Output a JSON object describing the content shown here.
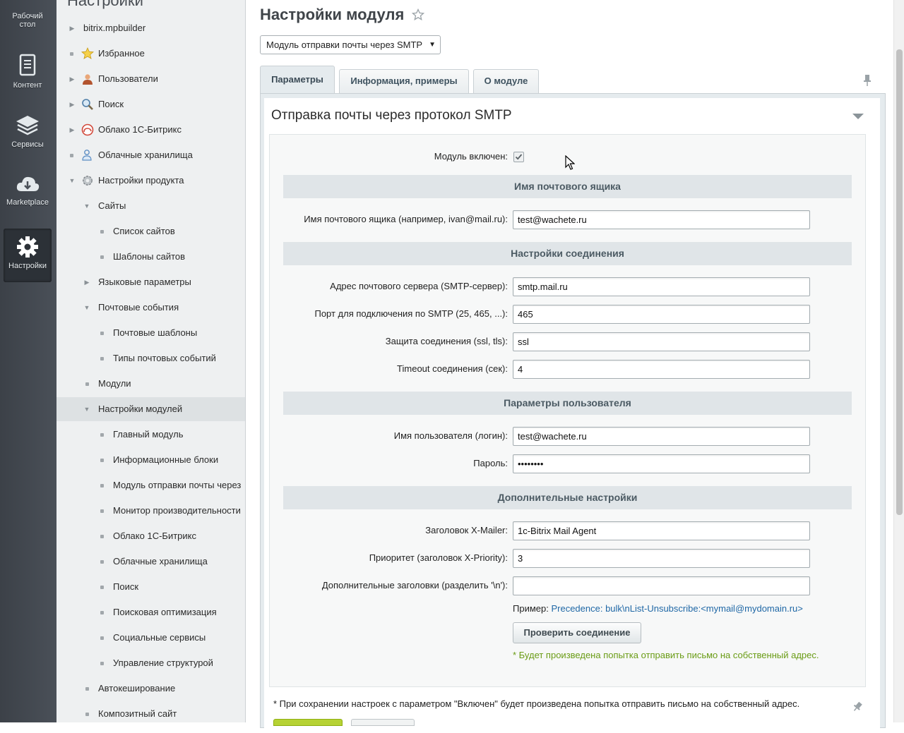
{
  "leftbar": {
    "items": [
      {
        "label": "Рабочий стол",
        "icon": "desktop-icon"
      },
      {
        "label": "Контент",
        "icon": "document-icon"
      },
      {
        "label": "Сервисы",
        "icon": "layers-icon"
      },
      {
        "label": "Marketplace",
        "icon": "cloud-download-icon"
      },
      {
        "label": "Настройки",
        "icon": "gear-icon"
      }
    ]
  },
  "menu": {
    "title": "Настройки",
    "items": [
      {
        "label": "bitrix.mpbuilder",
        "marker": "arrow-right"
      },
      {
        "label": "Избранное",
        "marker": "bullet",
        "icon": "star-icon"
      },
      {
        "label": "Пользователи",
        "marker": "arrow-right",
        "icon": "user-icon"
      },
      {
        "label": "Поиск",
        "marker": "arrow-right",
        "icon": "magnifier-icon"
      },
      {
        "label": "Облако 1С-Битрикс",
        "marker": "arrow-right",
        "icon": "cloud-icon"
      },
      {
        "label": "Облачные хранилища",
        "marker": "bullet",
        "icon": "storage-icon"
      },
      {
        "label": "Настройки продукта",
        "marker": "arrow-down",
        "icon": "settings-icon"
      },
      {
        "label": "Сайты",
        "marker": "arrow-down"
      },
      {
        "label": "Список сайтов",
        "marker": "bullet"
      },
      {
        "label": "Шаблоны сайтов",
        "marker": "bullet"
      },
      {
        "label": "Языковые параметры",
        "marker": "arrow-right"
      },
      {
        "label": "Почтовые события",
        "marker": "arrow-down"
      },
      {
        "label": "Почтовые шаблоны",
        "marker": "bullet"
      },
      {
        "label": "Типы почтовых событий",
        "marker": "bullet"
      },
      {
        "label": "Модули",
        "marker": "bullet"
      },
      {
        "label": "Настройки модулей",
        "marker": "arrow-down"
      },
      {
        "label": "Главный модуль",
        "marker": "bullet"
      },
      {
        "label": "Информационные блоки",
        "marker": "bullet"
      },
      {
        "label": "Модуль отправки почты через",
        "marker": "bullet"
      },
      {
        "label": "Монитор производительности",
        "marker": "bullet"
      },
      {
        "label": "Облако 1С-Битрикс",
        "marker": "bullet"
      },
      {
        "label": "Облачные хранилища",
        "marker": "bullet"
      },
      {
        "label": "Поиск",
        "marker": "bullet"
      },
      {
        "label": "Поисковая оптимизация",
        "marker": "bullet"
      },
      {
        "label": "Социальные сервисы",
        "marker": "bullet"
      },
      {
        "label": "Управление структурой",
        "marker": "bullet"
      },
      {
        "label": "Автокеширование",
        "marker": "bullet"
      },
      {
        "label": "Композитный сайт",
        "marker": "bullet"
      }
    ]
  },
  "page": {
    "title": "Настройки модуля",
    "module_select": "Модуль отправки почты через SMTP"
  },
  "tabs": [
    {
      "label": "Параметры",
      "active": true
    },
    {
      "label": "Информация, примеры",
      "active": false
    },
    {
      "label": "О модуле",
      "active": false
    }
  ],
  "form": {
    "section_title": "Отправка почты через протокол SMTP",
    "enabled_label": "Модуль включен:",
    "enabled": true,
    "group_mailbox": "Имя почтового ящика",
    "mailbox_label": "Имя почтового ящика (например, ivan@mail.ru):",
    "mailbox_value": "test@wachete.ru",
    "group_connection": "Настройки соединения",
    "server_label": "Адрес почтового сервера (SMTP-сервер):",
    "server_value": "smtp.mail.ru",
    "port_label": "Порт для подключения по SMTP (25, 465, ...):",
    "port_value": "465",
    "security_label": "Защита соединения (ssl, tls):",
    "security_value": "ssl",
    "timeout_label": "Timeout соединения (сек):",
    "timeout_value": "4",
    "group_user": "Параметры пользователя",
    "login_label": "Имя пользователя (логин):",
    "login_value": "test@wachete.ru",
    "password_label": "Пароль:",
    "password_value": "••••••••",
    "group_extra": "Дополнительные настройки",
    "xmailer_label": "Заголовок X-Mailer:",
    "xmailer_value": "1c-Bitrix Mail Agent",
    "priority_label": "Приоритет (заголовок X-Priority):",
    "priority_value": "3",
    "headers_label": "Дополнительные заголовки (разделить '\\n'):",
    "headers_value": "",
    "example_prefix": "Пример: ",
    "example_value": "Precedence: bulk\\nList-Unsubscribe:<mymail@mydomain.ru>",
    "check_button": "Проверить соединение",
    "hint_note": "* Будет произведена попытка отправить письмо на собственный адрес.",
    "footer_note": "* При сохранении настроек с параметром \"Включен\" будет произведена попытка отправить письмо на собственный адрес."
  },
  "colors": {
    "accent_green": "#6a9c15",
    "link_blue": "#2068a6",
    "save_green": "#b6d234"
  }
}
